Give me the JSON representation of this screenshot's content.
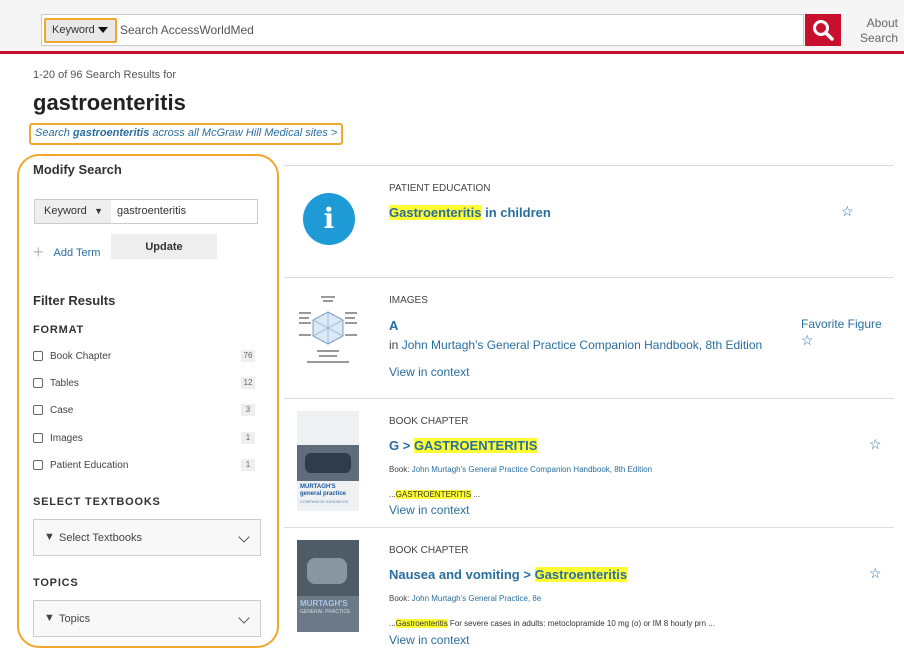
{
  "header": {
    "keyword_select": "Keyword",
    "search_placeholder": "Search AccessWorldMed",
    "search_value": "",
    "about_search": "About Search"
  },
  "results_header": {
    "count_text": "1-20 of 96 Search Results for",
    "query": "gastroenteritis",
    "search_all_pre": "Search ",
    "search_all_term": "gastroenteritis",
    "search_all_post": " across all McGraw Hill Medical sites >"
  },
  "sidebar": {
    "modify_heading": "Modify Search",
    "mod_select": "Keyword",
    "mod_value": "gastroenteritis",
    "add_term": "Add Term",
    "update": "Update",
    "filter_heading": "Filter Results",
    "format_title": "FORMAT",
    "format_items": [
      {
        "label": "Book Chapter",
        "count": "76"
      },
      {
        "label": "Tables",
        "count": "12"
      },
      {
        "label": "Case",
        "count": "3"
      },
      {
        "label": "Images",
        "count": "1"
      },
      {
        "label": "Patient Education",
        "count": "1"
      }
    ],
    "textbooks_title": "SELECT TEXTBOOKS",
    "textbooks_dd": "Select Textbooks",
    "topics_title": "TOPICS",
    "topics_dd": "Topics"
  },
  "results": [
    {
      "type": "PATIENT EDUCATION",
      "title_hl": "Gastroenteritis",
      "title_rest": " in children"
    },
    {
      "type": "IMAGES",
      "title": "A",
      "source_pre": "in ",
      "source": "John Murtagh's General Practice Companion Handbook, 8th Edition",
      "context": "View in context",
      "favorite": "Favorite Figure"
    },
    {
      "type": "BOOK CHAPTER",
      "title_pre": "G > ",
      "title_hl": "GASTROENTERITIS",
      "book_pre": "Book: ",
      "book": "John Murtagh's General Practice Companion Handbook, 8th Edition",
      "snippet_pre": "...",
      "snippet_hl": "GASTROENTERITIS",
      "snippet_post": " ...",
      "context": "View in context",
      "cover_brand": "MURTAGH'S",
      "cover_sub": "general practice",
      "cover_small": "COMPANION HANDBOOK"
    },
    {
      "type": "BOOK CHAPTER",
      "title_pre": "Nausea and vomiting > ",
      "title_hl": "Gastroenteritis",
      "book_pre": "Book: ",
      "book": "John Murtagh's General Practice, 8e",
      "snippet_pre": "...",
      "snippet_hl": "Gastroenteritis",
      "snippet_post": " For severe cases in adults: metoclopramide 10 mg (o) or IM 8 hourly prn ...",
      "context": "View in context",
      "cover_brand": "MURTAGH'S",
      "cover_sub": "GENERAL PRACTICE"
    }
  ],
  "colors": {
    "brand_red": "#c8102e",
    "link_blue": "#2a6e9f",
    "highlight": "#ffff33",
    "annotation_orange": "#f0a72b"
  },
  "icons": [
    "caret-down-icon",
    "search-icon",
    "plus-icon",
    "chevron-down-icon",
    "funnel-icon",
    "star-outline-icon",
    "info-icon"
  ]
}
